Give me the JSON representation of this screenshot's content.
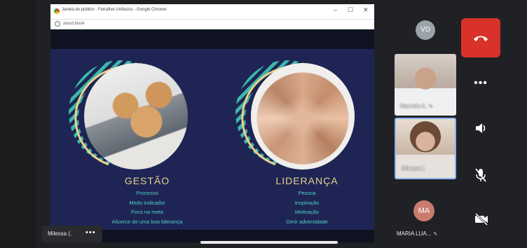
{
  "browser": {
    "window_title": "Janela do público - Ferrafive Unifaciss - Google Chrome",
    "url": "about:blank",
    "controls": {
      "minimize": "–",
      "maximize": "☐",
      "close": "✕"
    }
  },
  "slide": {
    "left": {
      "heading": "GESTÃO",
      "items": [
        "Processo",
        "Medo indicador",
        "Foco na meta",
        "Alicerce de uma boa liderança"
      ]
    },
    "right": {
      "heading": "LIDERANÇA",
      "items": [
        "Pessoa",
        "Inspiração",
        "Motivação",
        "Gerir adversidade"
      ]
    }
  },
  "presenter_pill": {
    "name": "Milessa (.",
    "more": "•••"
  },
  "participants": {
    "avatar_vd": "VD",
    "tile_1_name": "Marcelo A.",
    "tile_2_name": "Milessa (.",
    "avatar_ma": "MA",
    "ma_name": "MARIA LUA..."
  },
  "controls": {
    "more_label": "•••"
  },
  "colors": {
    "slide_bg": "#1e2555",
    "heading": "#e9d18b",
    "items": "#4fd1c5",
    "hangup": "#d9322b",
    "active_tile_border": "#8ab4f8"
  }
}
